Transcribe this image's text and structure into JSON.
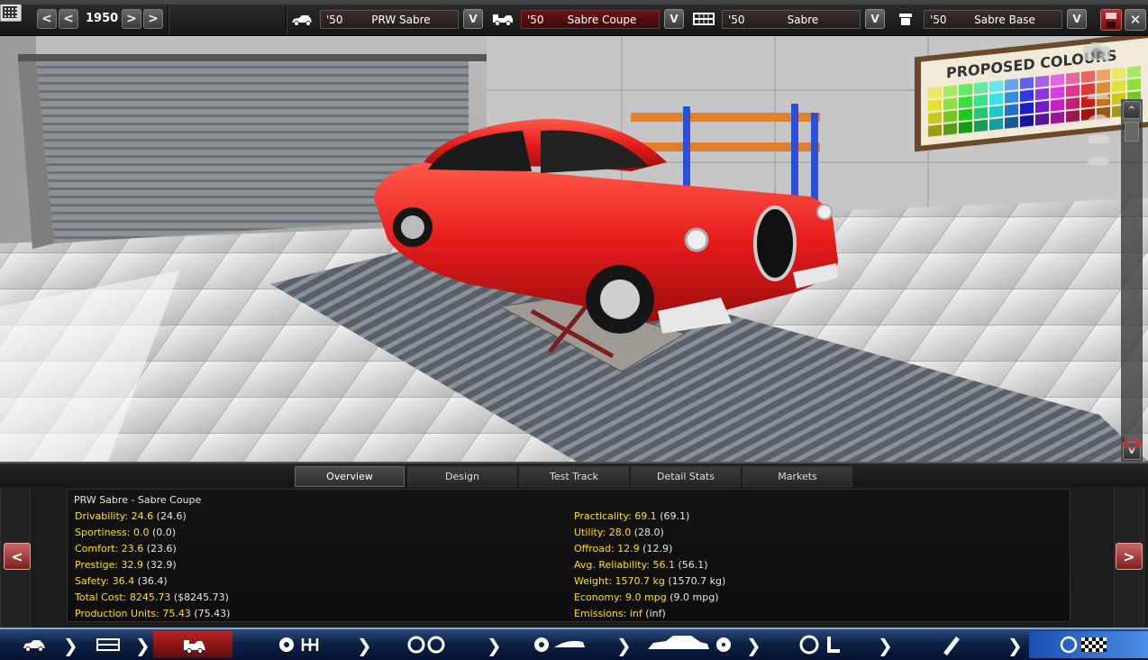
{
  "topbar": {
    "year": "1950",
    "prev_label": "<",
    "prev2_label": "<",
    "next_label": ">",
    "next2_label": ">",
    "dropdown_label": "V",
    "close_label": "✕",
    "slots": [
      {
        "icon": "car-model-icon",
        "year": "'50",
        "name": "PRW Sabre"
      },
      {
        "icon": "car-trim-icon",
        "year": "'50",
        "name": "Sabre Coupe"
      },
      {
        "icon": "chassis-icon",
        "year": "'50",
        "name": "Sabre"
      },
      {
        "icon": "engine-icon",
        "year": "'50",
        "name": "Sabre Base"
      }
    ]
  },
  "viewport": {
    "poster_text": "PROPOSED COLOURS",
    "scroll_up": "^",
    "scroll_down": "V",
    "car_color": "#e51b1b"
  },
  "tabs": [
    "Overview",
    "Design",
    "Test Track",
    "Detail Stats",
    "Markets"
  ],
  "panel": {
    "prev_label": "<",
    "next_label": ">",
    "title": "PRW Sabre - Sabre Coupe",
    "left_stats": [
      {
        "value": "Drivability: 24.6",
        "paren": " (24.6)"
      },
      {
        "value": "Sportiness: 0.0",
        "paren": " (0.0)"
      },
      {
        "value": "Comfort: 23.6",
        "paren": " (23.6)"
      },
      {
        "value": "Prestige: 32.9",
        "paren": " (32.9)"
      },
      {
        "value": "Safety: 36.4",
        "paren": " (36.4)"
      },
      {
        "value": "Total Cost: 8245.73",
        "paren": " ($8245.73)"
      },
      {
        "value": "Production Units: 75.43",
        "paren": " (75.43)"
      }
    ],
    "right_stats": [
      {
        "value": "Practicality: 69.1",
        "paren": " (69.1)"
      },
      {
        "value": "Utility: 28.0",
        "paren": " (28.0)"
      },
      {
        "value": "Offroad: 12.9",
        "paren": " (12.9)"
      },
      {
        "value": "Avg. Reliability: 56.1",
        "paren": " (56.1)"
      },
      {
        "value": "Weight: 1570.7 kg",
        "paren": " (1570.7 kg)"
      },
      {
        "value": "Economy: 9.0 mpg",
        "paren": " (9.0 mpg)"
      },
      {
        "value": "Emissions: inf",
        "paren": " (inf)"
      }
    ]
  },
  "bottomnav": {
    "items": [
      {
        "name": "car-model-icon"
      },
      {
        "name": "chassis-icon"
      },
      {
        "name": "car-trim-icon",
        "active": true
      },
      {
        "name": "engine-gearbox-icon"
      },
      {
        "name": "wheels-icon"
      },
      {
        "name": "suspension-icon"
      },
      {
        "name": "body-cooling-icon"
      },
      {
        "name": "steering-interior-icon"
      },
      {
        "name": "exhaust-icon"
      },
      {
        "name": "race-flag-icon"
      }
    ]
  },
  "colors": {
    "stat_value": "#ffe000",
    "accent_red": "#b22222",
    "nav_blue": "#0d2146"
  }
}
